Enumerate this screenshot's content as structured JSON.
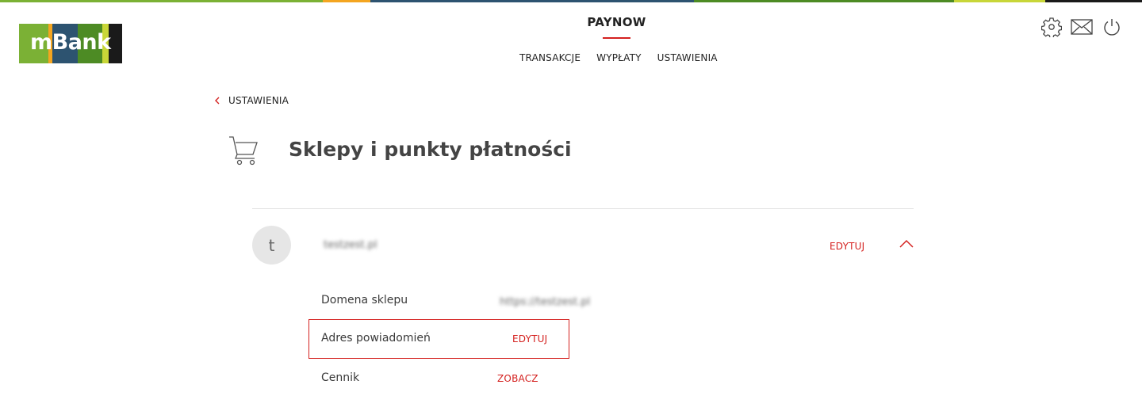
{
  "colors": {
    "accent": "#d4211f",
    "stripe": [
      "#7bb135",
      "#f4a520",
      "#2d5370",
      "#4d8b24",
      "#c8d638",
      "#1a1a1a"
    ],
    "logo": [
      "#7bb135",
      "#f4a520",
      "#2d5370",
      "#4d8b24",
      "#c8d638",
      "#1a1a1a"
    ]
  },
  "header": {
    "logo_text": "mBank",
    "brand": "PAYNOW",
    "nav": [
      "TRANSAKCJE",
      "WYPŁATY",
      "USTAWIENIA"
    ],
    "icons": [
      "gear-icon",
      "envelope-icon",
      "power-icon"
    ]
  },
  "breadcrumb": {
    "back_label": "USTAWIENIA"
  },
  "page": {
    "title": "Sklepy i punkty płatności"
  },
  "shop": {
    "avatar_letter": "t",
    "name": "testzest.pl",
    "edit_label": "EDYTUJ",
    "rows": [
      {
        "label": "Domena sklepu",
        "value": "https://testzest.pl"
      },
      {
        "label": "Adres powiadomień",
        "action": "EDYTUJ"
      },
      {
        "label": "Cennik",
        "action": "ZOBACZ"
      }
    ]
  }
}
